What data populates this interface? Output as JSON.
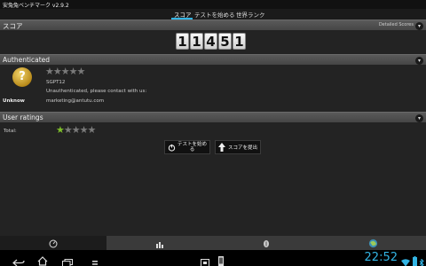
{
  "app": {
    "title": "安兔兔ベンチマーク v2.9.2"
  },
  "tabs": [
    {
      "label": "スコア",
      "active": true
    },
    {
      "label": "テストを始める",
      "active": false
    },
    {
      "label": "世界ランク",
      "active": false
    }
  ],
  "score_section": {
    "title": "スコア",
    "detailed_label": "Detailed Scores",
    "digits": [
      "1",
      "1",
      "4",
      "5",
      "1"
    ]
  },
  "auth_section": {
    "title": "Authenticated",
    "device_icon_glyph": "?",
    "rating_stars": 0,
    "max_stars": 5,
    "device_name": "SGPT12",
    "message": "Unauthenticated, please contact with us:",
    "model_label": "Unknow",
    "email": "marketing@antutu.com"
  },
  "ratings_section": {
    "title": "User ratings",
    "total_label": "Total:",
    "rating_stars": 1,
    "max_stars": 5
  },
  "actions": {
    "start_test_line1": "テストを始め",
    "start_test_line2": "る",
    "submit_score": "スコアを提出"
  },
  "bottom_tabs": [
    {
      "icon": "speedometer-icon",
      "active": true
    },
    {
      "icon": "bar-chart-icon",
      "active": false
    },
    {
      "icon": "info-icon",
      "active": false
    },
    {
      "icon": "globe-icon",
      "active": false
    }
  ],
  "status": {
    "time": "22:52"
  },
  "colors": {
    "accent": "#33b5e5",
    "star_on": "#7fbf2a",
    "device_icon": "#d4a52c"
  }
}
